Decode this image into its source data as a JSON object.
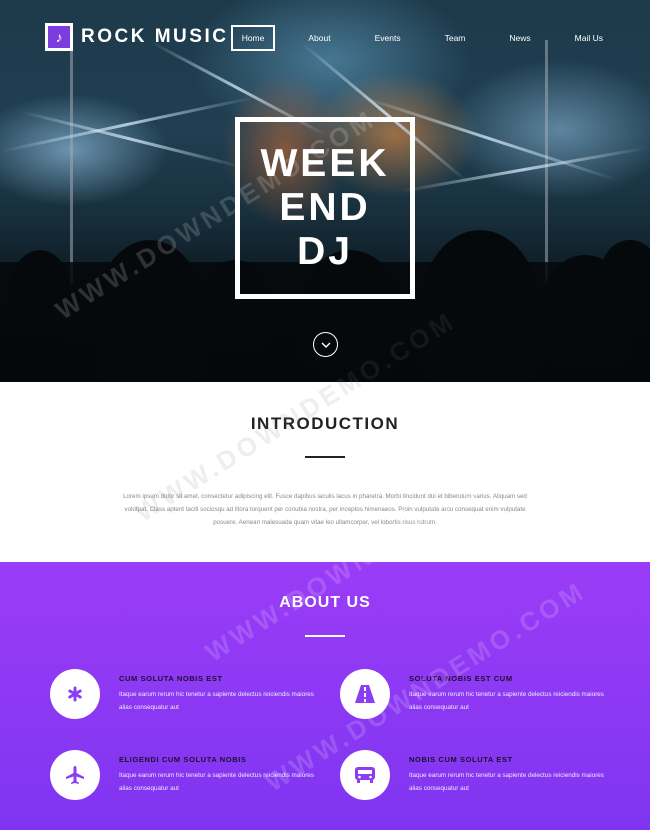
{
  "brand": {
    "name": "ROCK MUSIC",
    "logo_icon": "music-note-icon"
  },
  "nav": [
    {
      "label": "Home",
      "active": true
    },
    {
      "label": "About",
      "active": false
    },
    {
      "label": "Events",
      "active": false
    },
    {
      "label": "Team",
      "active": false
    },
    {
      "label": "News",
      "active": false
    },
    {
      "label": "Mail Us",
      "active": false
    }
  ],
  "hero": {
    "title_lines": [
      "WEEK",
      "END",
      "DJ"
    ],
    "scroll_icon": "chevron-down-icon"
  },
  "intro": {
    "title": "INTRODUCTION",
    "text": "Lorem ipsum dolor sit amet, consectetur adipiscing elit. Fusce dapibus iaculis lacus in pharetra. Morbi tincidunt dui et bibendum varius. Aliquam sed volutpat. Class aptent taciti sociosqu ad litora torquent per conubia nostra, per inceptos himenaeos. Proin vulputate arcu consequat enim vulputate posuere. Aenean malesuada quam vitae leo ullamcorper, vel lobortis risus rutrum."
  },
  "about": {
    "title": "ABOUT US",
    "features": [
      {
        "title": "CUM SOLUTA NOBIS EST",
        "text": "Itaque earum rerum hic tenetur a sapiente delectus reiciendis maiores alias consequatur aut",
        "icon": "asterisk-icon"
      },
      {
        "title": "SOLUTA NOBIS EST CUM",
        "text": "Itaque earum rerum hic tenetur a sapiente delectus reiciendis maiores alias consequatur aut",
        "icon": "road-icon"
      },
      {
        "title": "ELIGENDI CUM SOLUTA NOBIS",
        "text": "Itaque earum rerum hic tenetur a sapiente delectus reiciendis maiores alias consequatur aut",
        "icon": "airplane-icon"
      },
      {
        "title": "NOBIS CUM SOLUTA EST",
        "text": "Itaque earum rerum hic tenetur a sapiente delectus reiciendis maiores alias consequatur aut",
        "icon": "bus-icon"
      }
    ]
  },
  "watermark": "WWW.DOWNDEMO.COM",
  "colors": {
    "accent": "#8b3df4",
    "accent_dark": "#7b3dde",
    "icon": "#8b3df4"
  }
}
